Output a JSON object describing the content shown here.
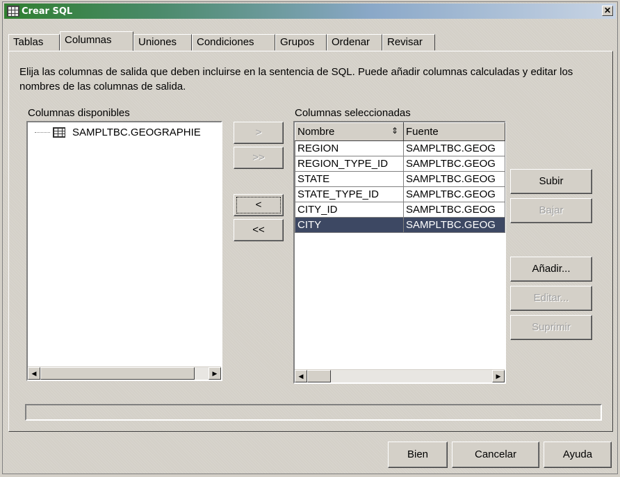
{
  "window": {
    "title": "Crear SQL",
    "close_label": "✕"
  },
  "tabs": [
    {
      "label": "Tablas"
    },
    {
      "label": "Columnas",
      "active": true
    },
    {
      "label": "Uniones"
    },
    {
      "label": "Condiciones"
    },
    {
      "label": "Grupos"
    },
    {
      "label": "Ordenar"
    },
    {
      "label": "Revisar"
    }
  ],
  "description": "Elija las columnas de salida que deben incluirse en la sentencia de SQL. Puede añadir columnas calculadas y editar los nombres de las columnas de salida.",
  "available": {
    "label": "Columnas disponibles",
    "items": [
      {
        "label": "SAMPLTBC.GEOGRAPHIE"
      }
    ]
  },
  "transfer": {
    "add_one": ">",
    "add_all": ">>",
    "remove_one": "<",
    "remove_all": "<<"
  },
  "selected": {
    "label": "Columnas seleccionadas",
    "columns": [
      "Nombre",
      "Fuente"
    ],
    "rows": [
      {
        "name": "REGION",
        "source": "SAMPLTBC.GEOG"
      },
      {
        "name": "REGION_TYPE_ID",
        "source": "SAMPLTBC.GEOG"
      },
      {
        "name": "STATE",
        "source": "SAMPLTBC.GEOG"
      },
      {
        "name": "STATE_TYPE_ID",
        "source": "SAMPLTBC.GEOG"
      },
      {
        "name": "CITY_ID",
        "source": "SAMPLTBC.GEOG"
      },
      {
        "name": "CITY",
        "source": "SAMPLTBC.GEOG",
        "selected": true
      }
    ]
  },
  "side_buttons": {
    "up": "Subir",
    "down": "Bajar",
    "add": "Añadir...",
    "edit": "Editar...",
    "delete": "Suprimir"
  },
  "footer": {
    "ok": "Bien",
    "cancel": "Cancelar",
    "help": "Ayuda"
  },
  "colors": {
    "selection": "#3d4863",
    "title_start": "#2f7f2f",
    "title_end": "#c8d4e4"
  }
}
